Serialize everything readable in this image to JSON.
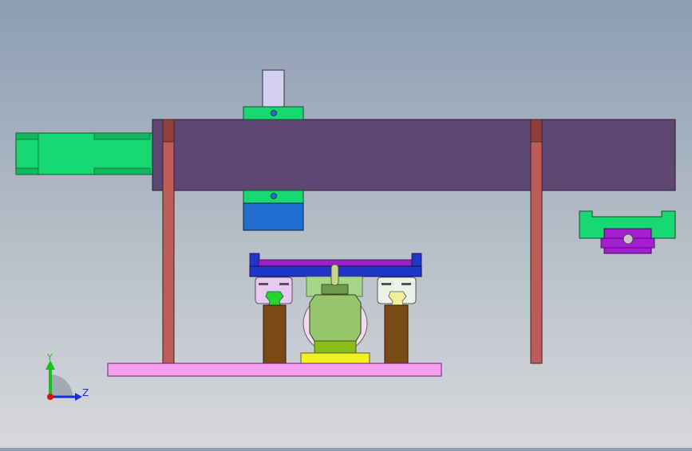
{
  "triad": {
    "y_label": "Y",
    "z_label": "Z",
    "colors": {
      "y": "#17c11a",
      "z": "#1c2fd6",
      "x": "#e01010"
    }
  },
  "colors": {
    "background_top": "#8c9db4",
    "background_bottom": "#d7d8dc",
    "beam": "#5e4672",
    "green_part": "#18d872",
    "blue_block": "#1f6fd2",
    "lavender_rod": "#d5cff2",
    "frame_post": "#bb5d58",
    "base_plate": "#f59ef0",
    "brown_column": "#7a4a14",
    "yellow_base": "#f2f21a",
    "motor_green": "#96c56c",
    "rail_blue": "#2036c8",
    "rail_purple": "#9d1fc8",
    "carriage_purple": "#a51fd0"
  }
}
